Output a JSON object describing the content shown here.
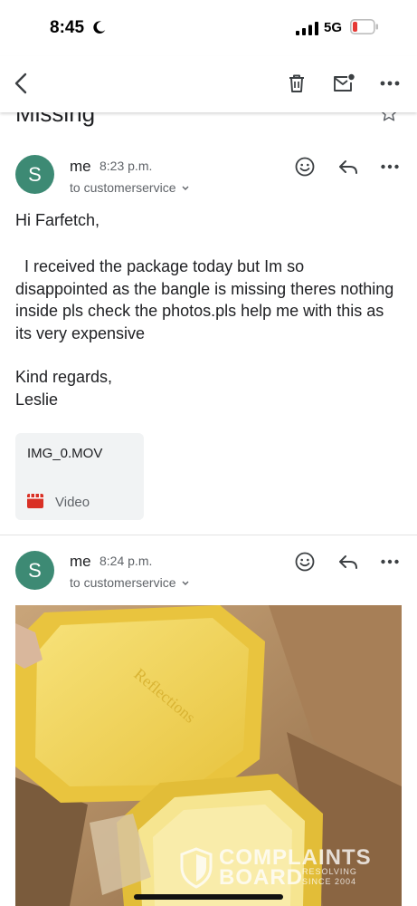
{
  "status_bar": {
    "time": "8:45",
    "network": "5G",
    "icons": [
      "moon-icon",
      "signal-bars-icon",
      "battery-low-icon"
    ]
  },
  "app_bar": {
    "icons": [
      "back-arrow-icon",
      "trash-icon",
      "mark-unread-icon",
      "more-vert-icon"
    ]
  },
  "thread": {
    "subject": "Missing"
  },
  "messages": [
    {
      "avatar_letter": "S",
      "sender": "me",
      "time": "8:23 p.m.",
      "recipient": "to customerservice",
      "greeting": "Hi Farfetch,",
      "paragraph": "I received the package today but Im so disappointed as the bangle is missing theres nothing inside pls check the photos.pls help me with this as its very expensive",
      "sign_off": "Kind regards,",
      "signature": "Leslie",
      "attachment": {
        "name": "IMG_0.MOV",
        "type": "Video"
      }
    },
    {
      "avatar_letter": "S",
      "sender": "me",
      "time": "8:24 p.m.",
      "recipient": "to customerservice"
    }
  ],
  "watermark": {
    "line1": "COMPLAINTS",
    "line2": "BOARD",
    "tag1": "RESOLVING",
    "tag2": "SINCE 2004"
  },
  "colors": {
    "avatar": "#3d8a74",
    "attachment_bg": "#f1f3f4",
    "video_icon": "#d93025",
    "battery_low": "#e53935",
    "box_yellow": "#f2d458",
    "cardboard": "#b58e63"
  }
}
